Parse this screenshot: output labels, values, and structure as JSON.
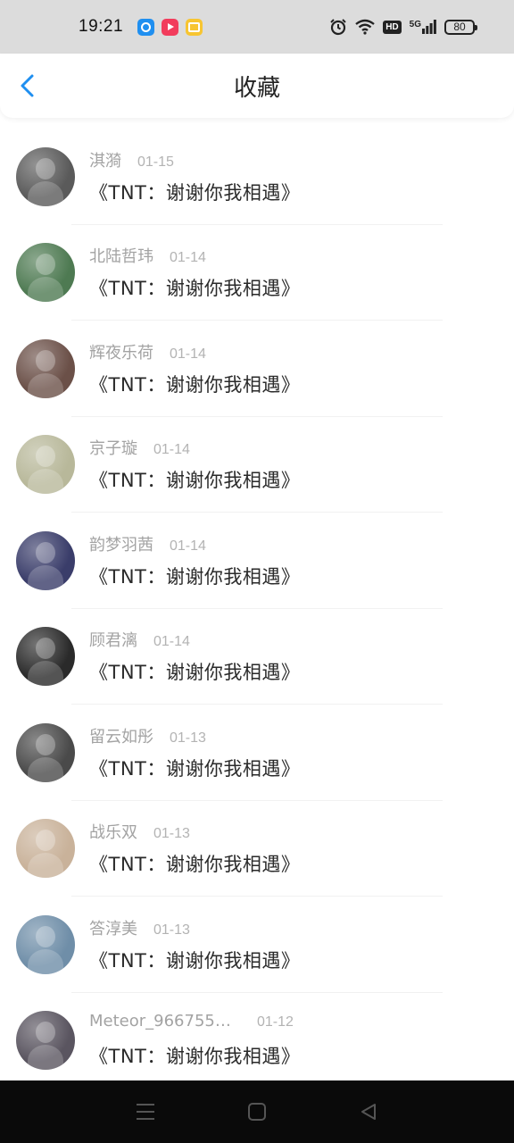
{
  "status_bar": {
    "time": "19:21",
    "network": "5G",
    "hd": "HD",
    "battery": "80"
  },
  "header": {
    "title": "收藏",
    "back_icon": "chevron-left-icon",
    "accent": "#1f8ff0"
  },
  "items": [
    {
      "name": "淇漪",
      "date": "01-15",
      "title": "《TNT：谢谢你我相遇》",
      "avatar_color": "#5a5a5a"
    },
    {
      "name": "北陆哲玮",
      "date": "01-14",
      "title": "《TNT：谢谢你我相遇》",
      "avatar_color": "#4e7a52"
    },
    {
      "name": "辉夜乐荷",
      "date": "01-14",
      "title": "《TNT：谢谢你我相遇》",
      "avatar_color": "#6b5048"
    },
    {
      "name": "京子璇",
      "date": "01-14",
      "title": "《TNT：谢谢你我相遇》",
      "avatar_color": "#b8b89a"
    },
    {
      "name": "韵梦羽茜",
      "date": "01-14",
      "title": "《TNT：谢谢你我相遇》",
      "avatar_color": "#3a3d6a"
    },
    {
      "name": "顾君漓",
      "date": "01-14",
      "title": "《TNT：谢谢你我相遇》",
      "avatar_color": "#2a2a2a"
    },
    {
      "name": "留云如彤",
      "date": "01-13",
      "title": "《TNT：谢谢你我相遇》",
      "avatar_color": "#4a4a4a"
    },
    {
      "name": "战乐双",
      "date": "01-13",
      "title": "《TNT：谢谢你我相遇》",
      "avatar_color": "#c9b29a"
    },
    {
      "name": "答淳美",
      "date": "01-13",
      "title": "《TNT：谢谢你我相遇》",
      "avatar_color": "#6f8ea8"
    },
    {
      "name": "Meteor_96675594...",
      "date": "01-12",
      "title": "《TNT：谢谢你我相遇》",
      "avatar_color": "#5a5560"
    }
  ],
  "nav": {
    "menu_icon": "menu-icon",
    "home_icon": "home-square-icon",
    "back_icon": "back-triangle-icon"
  }
}
